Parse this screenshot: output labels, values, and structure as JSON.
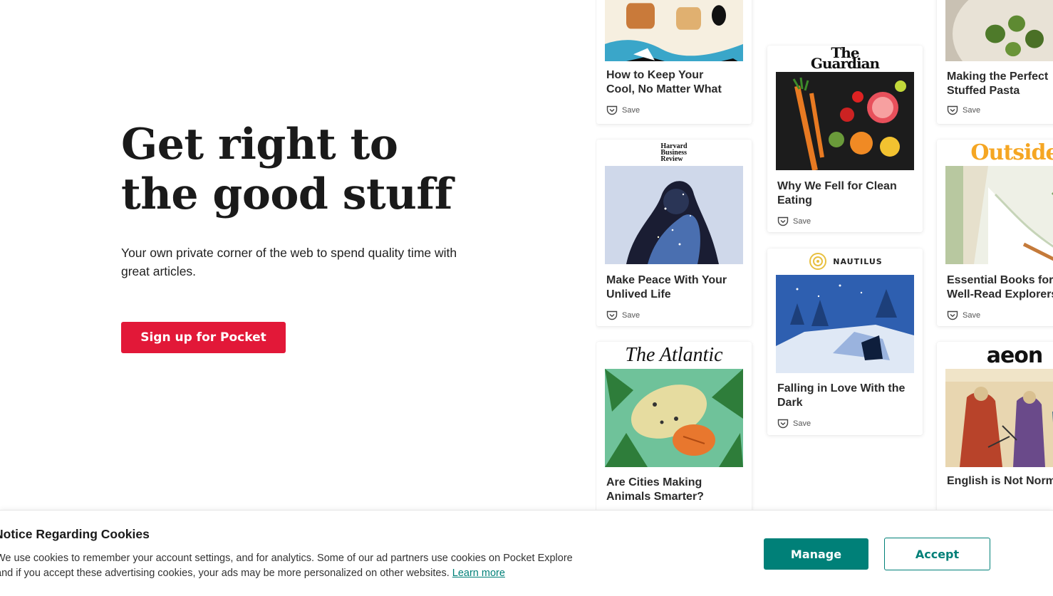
{
  "hero": {
    "headline_line1": "Get right to",
    "headline_line2": "the good stuff",
    "subtitle": "Your own private corner of the web to spend quality time with great articles.",
    "cta_label": "Sign up for Pocket"
  },
  "cards": {
    "save_label": "Save",
    "items": [
      {
        "publisher": "",
        "title_line1": "How to Keep Your",
        "title_line2": "Cool, No Matter What"
      },
      {
        "publisher": "Harvard Business Review",
        "publisher_lines": [
          "Harvard",
          "Business",
          "Review"
        ],
        "title_line1": "Make Peace With Your",
        "title_line2": "Unlived Life"
      },
      {
        "publisher": "The Atlantic",
        "title_line1": "Are Cities Making",
        "title_line2": "Animals Smarter?"
      },
      {
        "publisher": "The Guardian",
        "publisher_lines": [
          "The",
          "Guardian"
        ],
        "title_line1": "Why We Fell for Clean",
        "title_line2": "Eating"
      },
      {
        "publisher": "NAUTILUS",
        "title_line1": "Falling in Love With the",
        "title_line2": "Dark"
      },
      {
        "publisher": "",
        "title_line1": "Making the Perfect",
        "title_line2": "Stuffed Pasta"
      },
      {
        "publisher": "Outside",
        "title_line1": "Essential Books for",
        "title_line2": "Well-Read Explorers"
      },
      {
        "publisher": "aeon",
        "title_line1": "English is Not Normal",
        "title_line2": ""
      }
    ]
  },
  "cookie_banner": {
    "title": "Notice Regarding Cookies",
    "text_line1": "We use cookies to remember your account settings, and for analytics. Some of our ad partners use cookies on Pocket Explore",
    "text_line2": "and if you accept these advertising cookies, your ads may be more personalized on other websites.",
    "learn_more": "Learn more",
    "manage_label": "Manage",
    "accept_label": "Accept"
  },
  "colors": {
    "cta": "#e21838",
    "teal": "#008078",
    "outside_yellow": "#f5a623"
  }
}
